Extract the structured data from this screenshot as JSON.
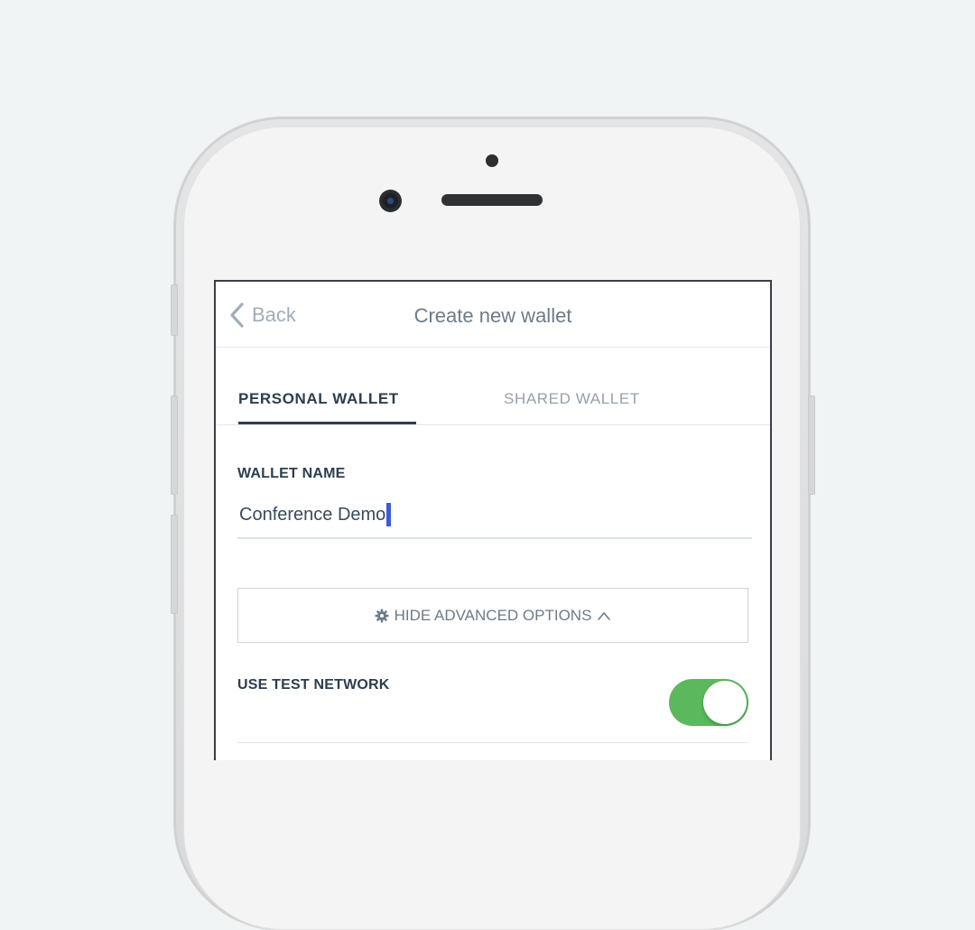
{
  "navbar": {
    "back_label": "Back",
    "title": "Create new wallet"
  },
  "tabs": [
    {
      "label": "PERSONAL WALLET",
      "active": true
    },
    {
      "label": "SHARED WALLET",
      "active": false
    }
  ],
  "form": {
    "wallet_name_label": "WALLET NAME",
    "wallet_name_value": "Conference Demo",
    "advanced_button_label": "HIDE ADVANCED OPTIONS",
    "test_network_label": "USE TEST NETWORK",
    "test_network_enabled": true
  },
  "colors": {
    "accent": "#2d3e4e",
    "toggle_on": "#5cb85c",
    "caret": "#3b5bdb"
  },
  "icons": {
    "back": "chevron-left-icon",
    "advanced": "gear-icon",
    "collapse": "chevron-up-icon"
  }
}
